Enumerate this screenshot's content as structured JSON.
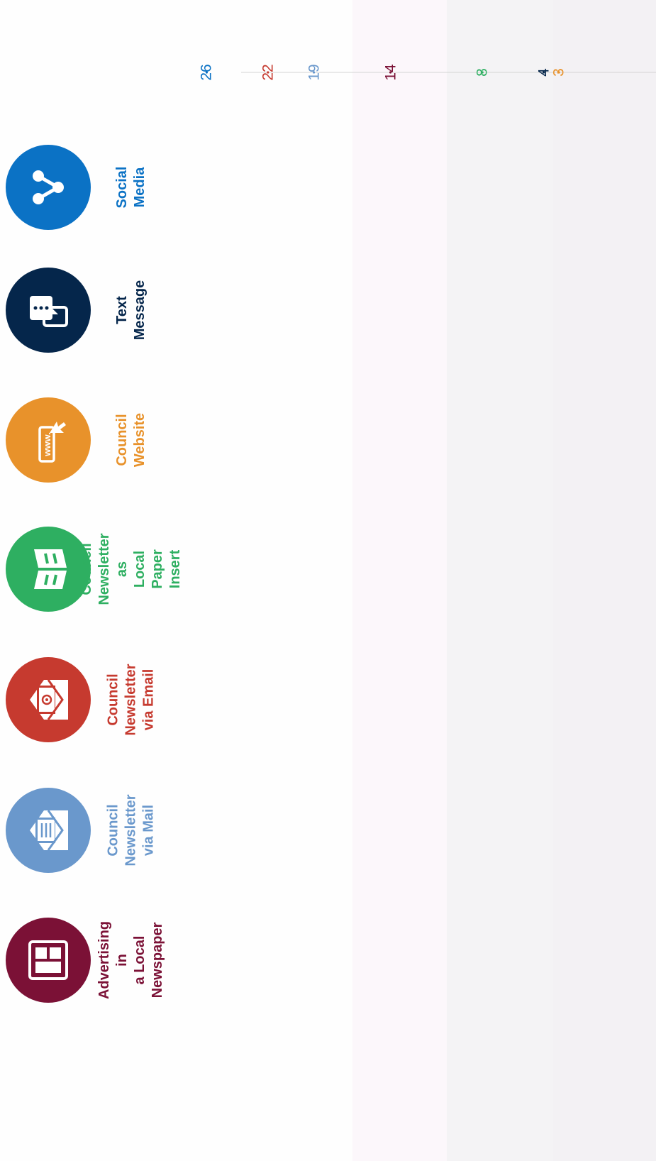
{
  "chart_data": {
    "type": "bar",
    "categories": [
      "Social\nMedia",
      "Text\nMessage",
      "Council\nWebsite",
      "Council\nNewsletter as\nLocal Paper Insert",
      "Council\nNewsletter\nvia Email",
      "Council\nNewsletter\nvia Mail",
      "Advertising in\na Local\nNewspaper"
    ],
    "values": [
      26,
      4,
      3,
      8,
      22,
      19,
      14
    ],
    "colors": [
      "#0b72c5",
      "#05264b",
      "#e8922b",
      "#2eaf61",
      "#c63a2f",
      "#6a98cc",
      "#7b1136"
    ],
    "icons": [
      "share-icon",
      "chat-phone-icon",
      "www-icon",
      "book-icon",
      "email-envelope-icon",
      "mail-envelope-icon",
      "newspaper-icon"
    ],
    "xlim": [
      0,
      30
    ]
  }
}
